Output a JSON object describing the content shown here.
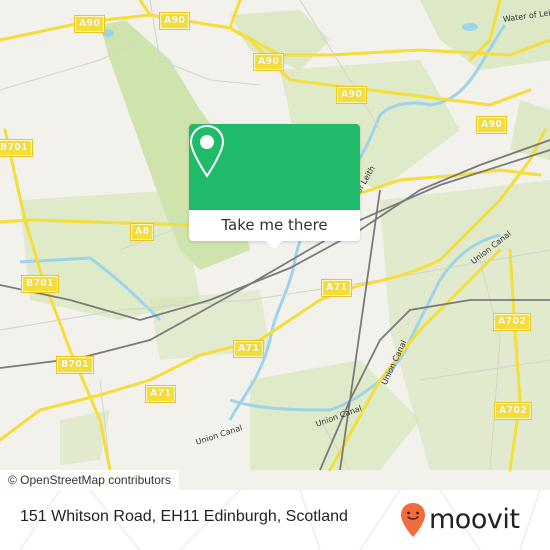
{
  "map": {
    "road_labels": [
      {
        "id": "a90-1",
        "text": "A90"
      },
      {
        "id": "a90-2",
        "text": "A90"
      },
      {
        "id": "a90-3",
        "text": "A90"
      },
      {
        "id": "a90-4",
        "text": "A90"
      },
      {
        "id": "a90-5",
        "text": "A90"
      },
      {
        "id": "b701-1",
        "text": "B701"
      },
      {
        "id": "b701-2",
        "text": "B701"
      },
      {
        "id": "b701-3",
        "text": "B701"
      },
      {
        "id": "a8",
        "text": "A8"
      },
      {
        "id": "a71-1",
        "text": "A71"
      },
      {
        "id": "a71-2",
        "text": "A71"
      },
      {
        "id": "a71-3",
        "text": "A71"
      },
      {
        "id": "a702-1",
        "text": "A702"
      },
      {
        "id": "a702-2",
        "text": "A702"
      }
    ],
    "water_labels": {
      "water_of_leith_1": "Water of Leith",
      "water_of_leith_2": "of Leith",
      "union_canal_1": "Union Canal",
      "union_canal_2": "Union Canal",
      "union_canal_3": "Union Canal",
      "union_canal_4": "Union Canal"
    },
    "attribution": "© OpenStreetMap contributors",
    "colors": {
      "background": "#f2f1ec",
      "green": "#cfe3ad",
      "road": "#f5dd3a",
      "water": "#9fd3ea",
      "rail": "#777777"
    }
  },
  "popup": {
    "icon": "map-pin-icon",
    "button_label": "Take me there",
    "color": "#1fba6a"
  },
  "footer": {
    "address": "151 Whitson Road, EH11 Edinburgh, Scotland",
    "brand": "moovit",
    "brand_icon": "moovit-smiley-pin-icon",
    "brand_color": "#f26b3a"
  }
}
